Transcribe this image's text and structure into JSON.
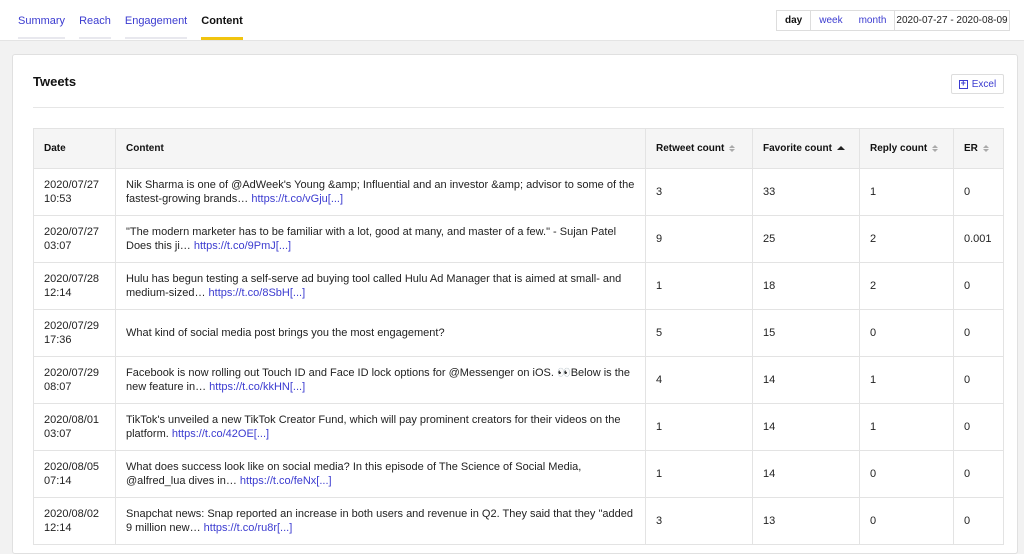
{
  "tabs": [
    {
      "label": "Summary",
      "active": false
    },
    {
      "label": "Reach",
      "active": false
    },
    {
      "label": "Engagement",
      "active": false
    },
    {
      "label": "Content",
      "active": true
    }
  ],
  "granularity": {
    "options": [
      "day",
      "week",
      "month"
    ],
    "selected": "day"
  },
  "date_range": "2020-07-27 - 2020-08-09",
  "card": {
    "title": "Tweets",
    "excel_label": "Excel"
  },
  "table": {
    "columns": [
      {
        "label": "Date",
        "sortable": false
      },
      {
        "label": "Content",
        "sortable": false
      },
      {
        "label": "Retweet count",
        "sortable": true,
        "sort": "none"
      },
      {
        "label": "Favorite count",
        "sortable": true,
        "sort": "asc"
      },
      {
        "label": "Reply count",
        "sortable": true,
        "sort": "none"
      },
      {
        "label": "ER",
        "sortable": true,
        "sort": "none"
      }
    ],
    "rows": [
      {
        "date": "2020/07/27",
        "time": "10:53",
        "text": "Nik Sharma is one of @AdWeek's Young &amp; Influential and an investor &amp; advisor to some of the fastest-growing brands… ",
        "link": "https://t.co/vGju[...]",
        "retweets": "3",
        "favorites": "33",
        "replies": "1",
        "er": "0"
      },
      {
        "date": "2020/07/27",
        "time": "03:07",
        "text": "\"The modern marketer has to be familiar with a lot, good at many, and master of a few.\" - Sujan Patel Does this ji… ",
        "link": "https://t.co/9PmJ[...]",
        "retweets": "9",
        "favorites": "25",
        "replies": "2",
        "er": "0.001"
      },
      {
        "date": "2020/07/28",
        "time": "12:14",
        "text": "Hulu has begun testing a self-serve ad buying tool called Hulu Ad Manager that is aimed at small- and medium-sized… ",
        "link": "https://t.co/8SbH[...]",
        "retweets": "1",
        "favorites": "18",
        "replies": "2",
        "er": "0"
      },
      {
        "date": "2020/07/29",
        "time": "17:36",
        "text": "What kind of social media post brings you the most engagement?",
        "link": "",
        "retweets": "5",
        "favorites": "15",
        "replies": "0",
        "er": "0"
      },
      {
        "date": "2020/07/29",
        "time": "08:07",
        "text": "Facebook is now rolling out Touch ID and Face ID lock options for @Messenger on iOS. 👀Below is the new feature in… ",
        "link": "https://t.co/kkHN[...]",
        "retweets": "4",
        "favorites": "14",
        "replies": "1",
        "er": "0"
      },
      {
        "date": "2020/08/01",
        "time": "03:07",
        "text": "TikTok's unveiled a new TikTok Creator Fund, which will pay prominent creators for their videos on the platform. ",
        "link": "https://t.co/42OE[...]",
        "retweets": "1",
        "favorites": "14",
        "replies": "1",
        "er": "0"
      },
      {
        "date": "2020/08/05",
        "time": "07:14",
        "text": "What does success look like on social media? In this episode of The Science of Social Media, @alfred_lua dives in… ",
        "link": "https://t.co/feNx[...]",
        "retweets": "1",
        "favorites": "14",
        "replies": "0",
        "er": "0"
      },
      {
        "date": "2020/08/02",
        "time": "12:14",
        "text": "Snapchat news: Snap reported an increase in both users and revenue in Q2. They said that they \"added 9 million new… ",
        "link": "https://t.co/ru8r[...]",
        "retweets": "3",
        "favorites": "13",
        "replies": "0",
        "er": "0"
      }
    ]
  },
  "colors": {
    "accent": "#3b3bd0",
    "active_tab_underline": "#f1c40f"
  }
}
